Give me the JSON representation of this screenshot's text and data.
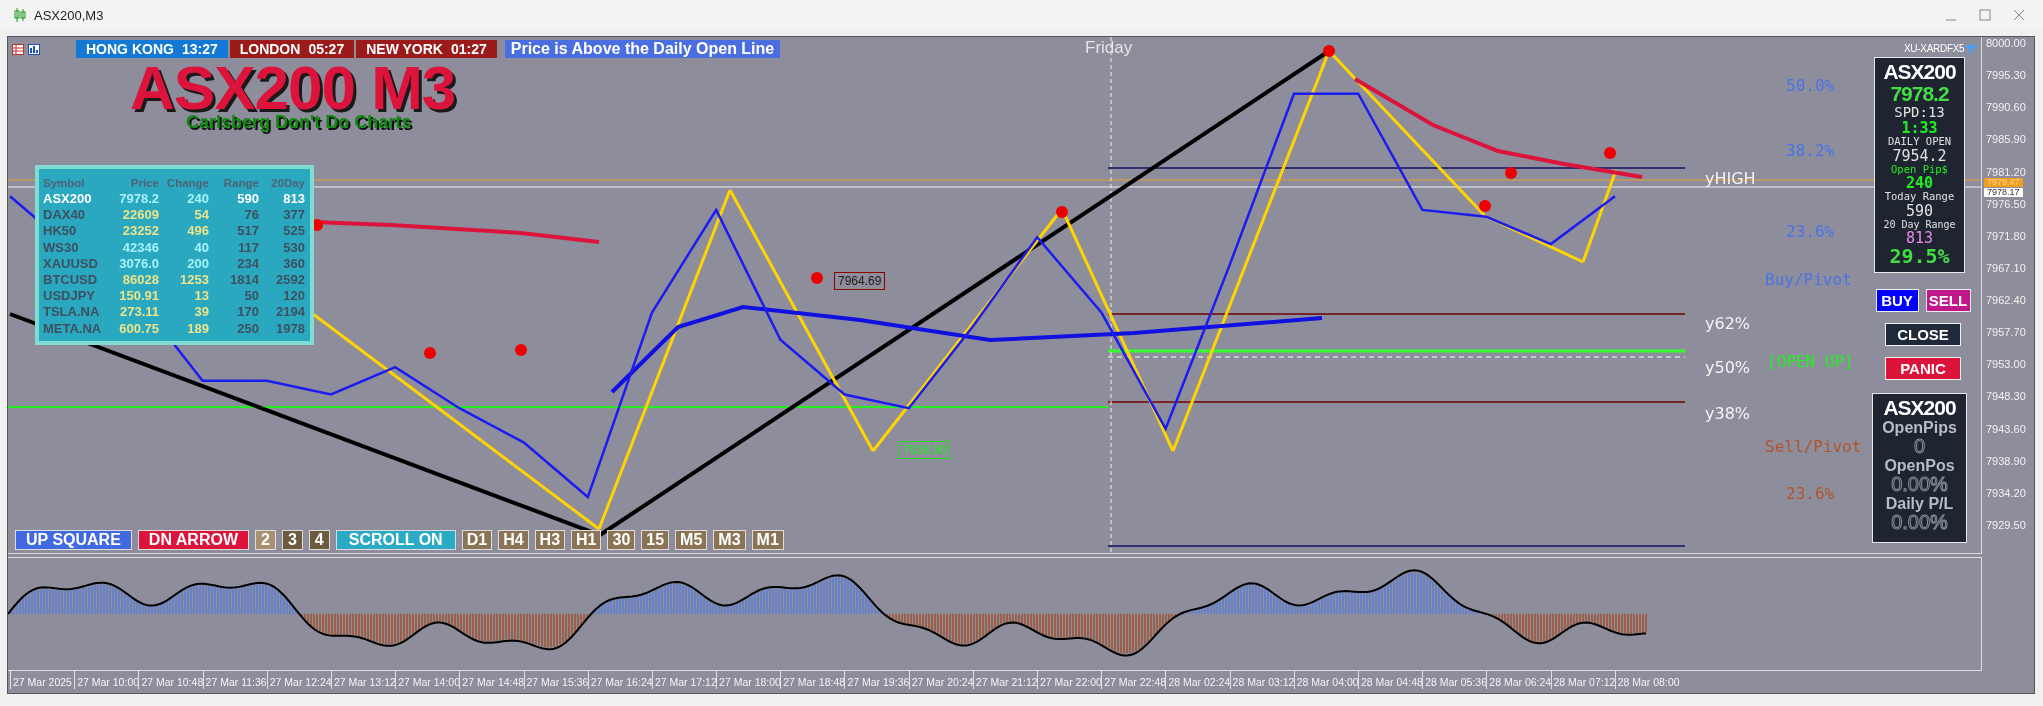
{
  "window": {
    "title": "ASX200,M3"
  },
  "top_bar": {
    "sessions": [
      {
        "city": "HONG KONG",
        "time": "13:27",
        "kind": "open"
      },
      {
        "city": "LONDON",
        "time": "05:27",
        "kind": "closed"
      },
      {
        "city": "NEW YORK",
        "time": "01:27",
        "kind": "closed"
      }
    ],
    "banner": "Price is Above the Daily Open Line"
  },
  "day_label": "Friday",
  "title": "ASX200 M3",
  "subtitle": "Carlsberg Don't Do Charts",
  "watchlist": {
    "columns": [
      "Symbol",
      "Price",
      "Change",
      "Range",
      "20Day"
    ],
    "rows": [
      {
        "cells": [
          "ASX200",
          "7978.2",
          "240",
          "590",
          "813"
        ],
        "selected": true,
        "kind": "up"
      },
      {
        "cells": [
          "DAX40",
          "22609",
          "54",
          "76",
          "377"
        ],
        "selected": false,
        "kind": "down"
      },
      {
        "cells": [
          "HK50",
          "23252",
          "496",
          "517",
          "525"
        ],
        "selected": false,
        "kind": "down"
      },
      {
        "cells": [
          "WS30",
          "42346",
          "40",
          "117",
          "530"
        ],
        "selected": false,
        "kind": "up"
      },
      {
        "cells": [
          "XAUUSD",
          "3076.0",
          "200",
          "234",
          "360"
        ],
        "selected": false,
        "kind": "up"
      },
      {
        "cells": [
          "BTCUSD",
          "86028",
          "1253",
          "1814",
          "2592"
        ],
        "selected": false,
        "kind": "down"
      },
      {
        "cells": [
          "USDJPY",
          "150.91",
          "13",
          "50",
          "120"
        ],
        "selected": false,
        "kind": "down"
      },
      {
        "cells": [
          "TSLA.NA",
          "273.11",
          "39",
          "170",
          "2194"
        ],
        "selected": false,
        "kind": "down"
      },
      {
        "cells": [
          "META.NA",
          "600.75",
          "189",
          "250",
          "1978"
        ],
        "selected": false,
        "kind": "down"
      }
    ]
  },
  "broker_label": "XU-XARDFX5",
  "info_panel": {
    "symbol": "ASX200",
    "price": "7978.2",
    "spread": "SPD:13",
    "timer": "1:33",
    "daily_open_label": "DAILY OPEN",
    "daily_open": "7954.2",
    "open_pips_label": "Open Pip$",
    "open_pips": "240",
    "today_range_label": "Today Range",
    "today_range": "590",
    "day20_label": "20 Day Range",
    "day20": "813",
    "ratio": "29.5%"
  },
  "trade_buttons": [
    {
      "label": "BUY",
      "kind": "buy"
    },
    {
      "label": "SELL",
      "kind": "sell"
    },
    {
      "label": "CLOSE",
      "kind": "close"
    },
    {
      "label": "PANIC",
      "kind": "panic"
    }
  ],
  "position_panel": {
    "symbol": "ASX200",
    "items": [
      {
        "label": "OpenPips",
        "value": "0"
      },
      {
        "label": "OpenPos",
        "value": "0.00%"
      },
      {
        "label": "Daily P/L",
        "value": "0.00%"
      }
    ]
  },
  "levels": [
    {
      "text": "50.0%",
      "kind": "fib-up"
    },
    {
      "text": "38.2%",
      "kind": "fib-up"
    },
    {
      "text": "yHIGH",
      "kind": "line"
    },
    {
      "text": "23.6%",
      "kind": "fib-up"
    },
    {
      "text": "Buy/Pivot",
      "kind": "pivot-buy"
    },
    {
      "text": "y62%",
      "kind": "line"
    },
    {
      "text": "y50%",
      "kind": "line"
    },
    {
      "text": "[OPEN UP]",
      "kind": "open"
    },
    {
      "text": "y38%",
      "kind": "line"
    },
    {
      "text": "Sell/Pivot",
      "kind": "pivot-sell"
    },
    {
      "text": "23.6%",
      "kind": "fib-down"
    }
  ],
  "price_tags": [
    {
      "text": "7964.69",
      "kind": "high"
    },
    {
      "text": "7938.90",
      "kind": "low"
    }
  ],
  "toolbar": {
    "modes": [
      {
        "label": "UP SQUARE",
        "kind": "up"
      },
      {
        "label": "DN ARROW",
        "kind": "down"
      }
    ],
    "counts": [
      {
        "label": "2",
        "selected": true
      },
      {
        "label": "3",
        "selected": false
      },
      {
        "label": "4",
        "selected": false
      }
    ],
    "scroll": "SCROLL ON",
    "periods": [
      "D1",
      "H4",
      "H3",
      "H1",
      "30",
      "15",
      "M5",
      "M3",
      "M1"
    ]
  },
  "price_axis": {
    "ticks": [
      "8000.00",
      "7995.30",
      "7990.60",
      "7985.90",
      "7981.20",
      "7976.50",
      "7971.80",
      "7967.10",
      "7962.40",
      "7957.70",
      "7953.00",
      "7948.30",
      "7943.60",
      "7938.90",
      "7934.20",
      "7929.50"
    ],
    "ask": "7979.47",
    "bid": "7978.17"
  },
  "time_axis": [
    "27 Mar 2025",
    "27 Mar 10:00",
    "27 Mar 10:48",
    "27 Mar 11:36",
    "27 Mar 12:24",
    "27 Mar 13:12",
    "27 Mar 14:00",
    "27 Mar 14:48",
    "27 Mar 15:36",
    "27 Mar 16:24",
    "27 Mar 17:12",
    "27 Mar 18:00",
    "27 Mar 18:48",
    "27 Mar 19:36",
    "27 Mar 20:24",
    "27 Mar 21:12",
    "27 Mar 22:00",
    "27 Mar 22:48",
    "28 Mar 02:24",
    "28 Mar 03:12",
    "28 Mar 04:00",
    "28 Mar 04:48",
    "28 Mar 05:36",
    "28 Mar 06:24",
    "28 Mar 07:12",
    "28 Mar 08:00"
  ]
}
